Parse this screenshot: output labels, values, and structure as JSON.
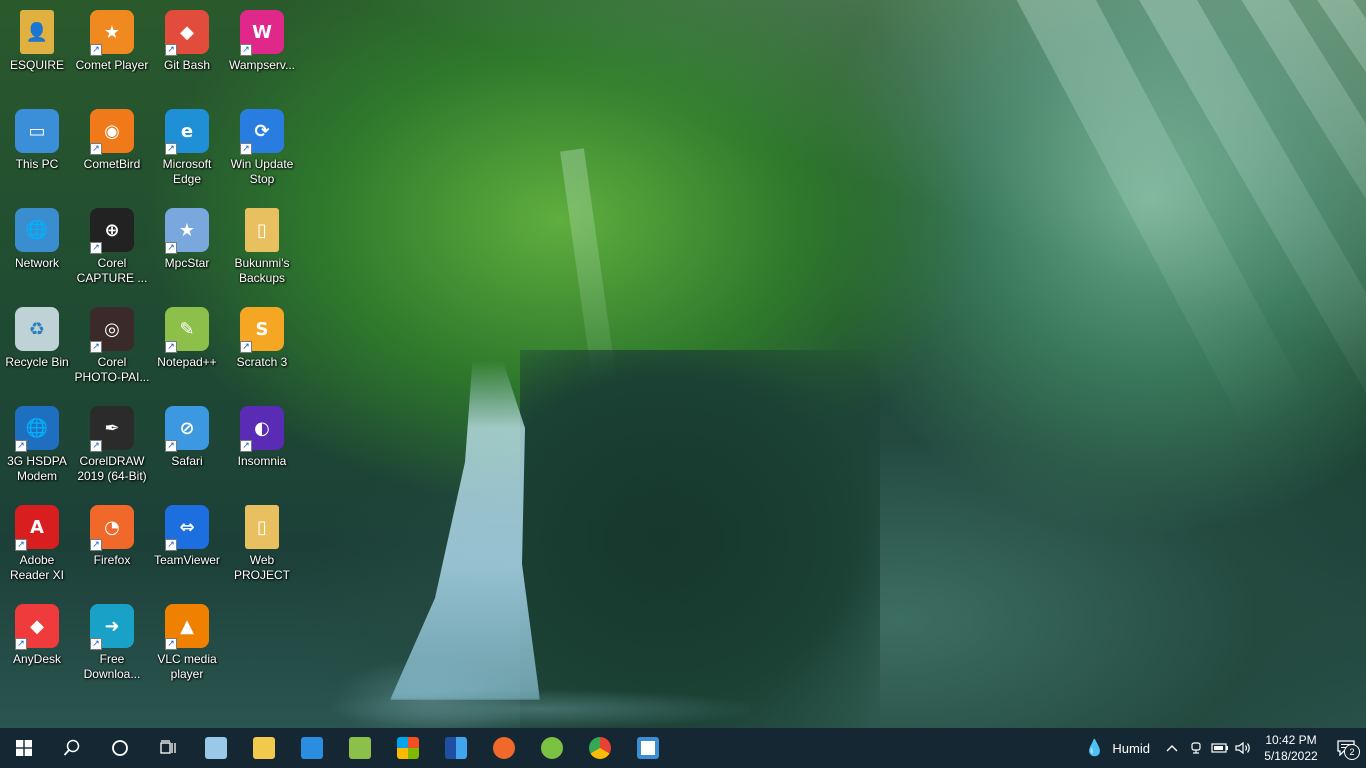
{
  "desktop": {
    "icons": [
      {
        "label": "ESQUIRE",
        "icon": "user-folder-icon",
        "shortcut": false,
        "color": "#e0b040"
      },
      {
        "label": "Comet Player",
        "icon": "comet-player-icon",
        "shortcut": true,
        "color": "#f08a20"
      },
      {
        "label": "Git Bash",
        "icon": "git-bash-icon",
        "shortcut": true,
        "color": "#e24c3c"
      },
      {
        "label": "Wampserv...",
        "icon": "wampserver-icon",
        "shortcut": true,
        "color": "#e0288a"
      },
      {
        "label": "This PC",
        "icon": "this-pc-icon",
        "shortcut": false,
        "color": "#3b8fd8"
      },
      {
        "label": "CometBird",
        "icon": "cometbird-icon",
        "shortcut": true,
        "color": "#f07a1a"
      },
      {
        "label": "Microsoft\nEdge",
        "icon": "edge-icon",
        "shortcut": true,
        "color": "#1f8fd6"
      },
      {
        "label": "Win Update\nStop",
        "icon": "win-update-stop-icon",
        "shortcut": true,
        "color": "#2a7de0"
      },
      {
        "label": "Network",
        "icon": "network-icon",
        "shortcut": false,
        "color": "#3a8ed0"
      },
      {
        "label": "Corel\nCAPTURE ...",
        "icon": "corel-capture-icon",
        "shortcut": true,
        "color": "#222222"
      },
      {
        "label": "MpcStar",
        "icon": "mpcstar-icon",
        "shortcut": true,
        "color": "#7aa7de"
      },
      {
        "label": "Bukunmi's\nBackups",
        "icon": "backup-folder-icon",
        "shortcut": false,
        "color": "#e8c060"
      },
      {
        "label": "Recycle Bin",
        "icon": "recycle-bin-icon",
        "shortcut": false,
        "color": "#c9dbe6"
      },
      {
        "label": "Corel\nPHOTO-PAI...",
        "icon": "corel-photo-paint-icon",
        "shortcut": true,
        "color": "#3a2a2a"
      },
      {
        "label": "Notepad++",
        "icon": "notepad-plus-plus-icon",
        "shortcut": true,
        "color": "#8cc04a"
      },
      {
        "label": "Scratch 3",
        "icon": "scratch-icon",
        "shortcut": true,
        "color": "#f5a623"
      },
      {
        "label": "3G HSDPA\nModem",
        "icon": "modem-globe-icon",
        "shortcut": true,
        "color": "#1f6fc0"
      },
      {
        "label": "CorelDRAW\n2019 (64-Bit)",
        "icon": "coreldraw-icon",
        "shortcut": true,
        "color": "#2b2b2b"
      },
      {
        "label": "Safari",
        "icon": "safari-icon",
        "shortcut": true,
        "color": "#3c98e0"
      },
      {
        "label": "Insomnia",
        "icon": "insomnia-icon",
        "shortcut": true,
        "color": "#5a2bb5"
      },
      {
        "label": "Adobe\nReader XI",
        "icon": "adobe-reader-icon",
        "shortcut": true,
        "color": "#d81e1e"
      },
      {
        "label": "Firefox",
        "icon": "firefox-icon",
        "shortcut": true,
        "color": "#f0682a"
      },
      {
        "label": "TeamViewer",
        "icon": "teamviewer-icon",
        "shortcut": true,
        "color": "#1d6fe0"
      },
      {
        "label": "Web\nPROJECT",
        "icon": "web-project-folder-icon",
        "shortcut": false,
        "color": "#e8c060"
      },
      {
        "label": "AnyDesk",
        "icon": "anydesk-icon",
        "shortcut": true,
        "color": "#ef3b3b"
      },
      {
        "label": "Free\nDownloa...",
        "icon": "free-download-manager-icon",
        "shortcut": true,
        "color": "#1aa1c8"
      },
      {
        "label": "VLC media\nplayer",
        "icon": "vlc-icon",
        "shortcut": true,
        "color": "#f08000"
      }
    ]
  },
  "taskbar": {
    "pinned": [
      {
        "name": "start-button",
        "icon": "windows-logo-icon",
        "color": "#ffffff"
      },
      {
        "name": "search-button",
        "icon": "search-icon",
        "color": "#ffffff"
      },
      {
        "name": "cortana-button",
        "icon": "cortana-ring-icon",
        "color": "#ffffff"
      },
      {
        "name": "task-view-button",
        "icon": "task-view-icon",
        "color": "#ffffff"
      },
      {
        "name": "taskbar-app-unknown",
        "icon": "glass-app-icon",
        "color": "#9ac8e8"
      },
      {
        "name": "taskbar-file-explorer",
        "icon": "folder-icon",
        "color": "#f2c94c"
      },
      {
        "name": "taskbar-mail",
        "icon": "mail-icon",
        "color": "#2a8de0"
      },
      {
        "name": "taskbar-notepad-plus-plus",
        "icon": "notepad-plus-plus-icon",
        "color": "#8cc04a"
      },
      {
        "name": "taskbar-microsoft-store",
        "icon": "store-icon",
        "color": "#f25022"
      },
      {
        "name": "taskbar-word",
        "icon": "word-icon",
        "color": "#2b5fb5"
      },
      {
        "name": "taskbar-firefox",
        "icon": "firefox-icon",
        "color": "#f0682a"
      },
      {
        "name": "taskbar-coreldraw",
        "icon": "coreldraw-icon",
        "color": "#7cc242"
      },
      {
        "name": "taskbar-chrome",
        "icon": "chrome-icon",
        "color": "#e94235"
      },
      {
        "name": "taskbar-unknown-app",
        "icon": "square-bracket-app-icon",
        "color": "#3c8fd6"
      }
    ],
    "tray": {
      "weather_label": "Humid",
      "time": "10:42 PM",
      "date": "5/18/2022",
      "notification_count": "2"
    }
  }
}
